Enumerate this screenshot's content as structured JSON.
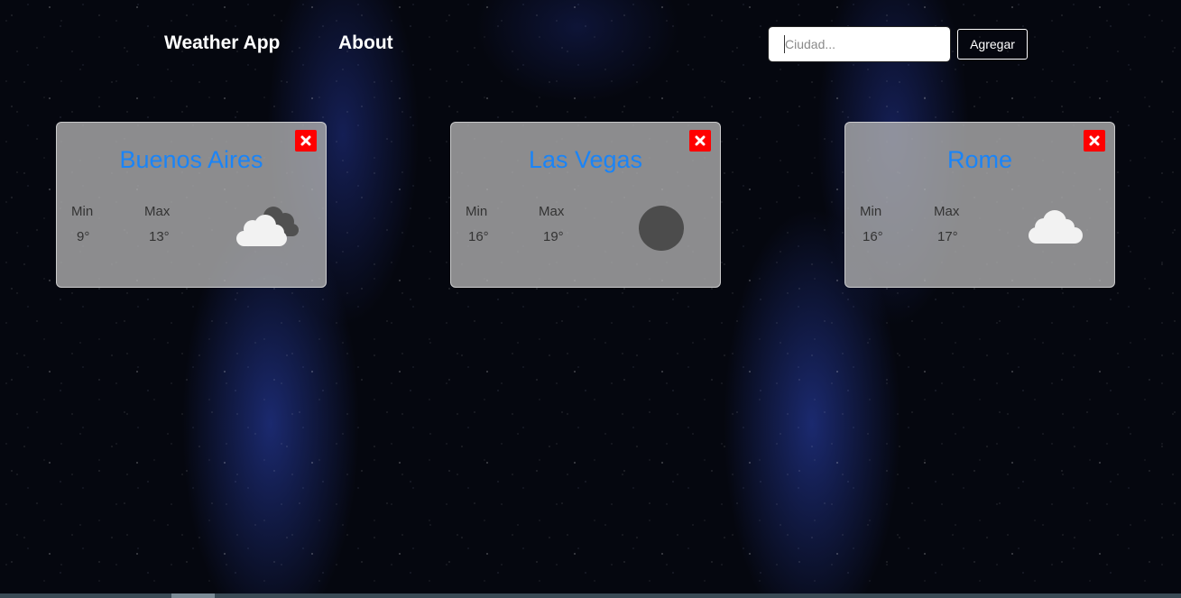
{
  "nav": {
    "brand": "Weather App",
    "about": "About"
  },
  "search": {
    "placeholder": "Ciudad...",
    "value": "",
    "button_label": "Agregar"
  },
  "cards": [
    {
      "city": "Buenos Aires",
      "min_label": "Min",
      "max_label": "Max",
      "min": "9°",
      "max": "13°",
      "icon": "broken-clouds-icon"
    },
    {
      "city": "Las Vegas",
      "min_label": "Min",
      "max_label": "Max",
      "min": "16°",
      "max": "19°",
      "icon": "clear-sky-night-icon"
    },
    {
      "city": "Rome",
      "min_label": "Min",
      "max_label": "Max",
      "min": "16°",
      "max": "17°",
      "icon": "few-clouds-icon"
    }
  ],
  "colors": {
    "city_title": "#1a84f7",
    "close_button": "#ff0000",
    "card_background": "rgba(178,178,178,0.78)"
  }
}
